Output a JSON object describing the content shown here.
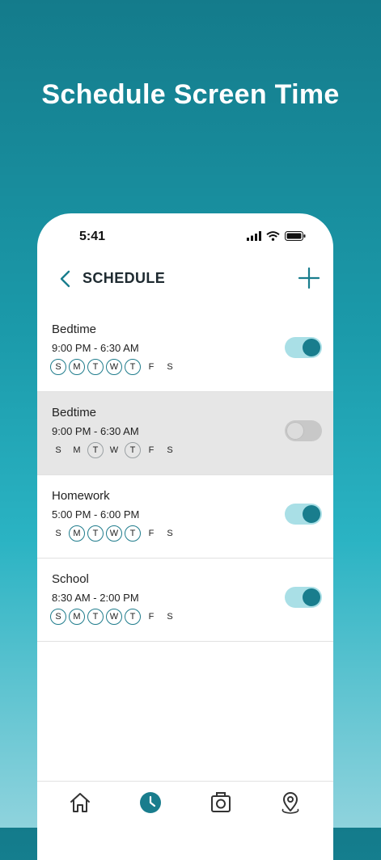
{
  "headline": "Schedule Screen Time",
  "status": {
    "time": "5:41"
  },
  "nav": {
    "title": "SCHEDULE"
  },
  "schedules": [
    {
      "name": "Bedtime",
      "time": "9:00 PM - 6:30 AM",
      "enabled": true,
      "days": [
        {
          "l": "S",
          "on": true
        },
        {
          "l": "M",
          "on": true
        },
        {
          "l": "T",
          "on": true
        },
        {
          "l": "W",
          "on": true
        },
        {
          "l": "T",
          "on": true
        },
        {
          "l": "F",
          "on": false
        },
        {
          "l": "S",
          "on": false
        }
      ]
    },
    {
      "name": "Bedtime",
      "time": "9:00 PM - 6:30 AM",
      "enabled": false,
      "days": [
        {
          "l": "S",
          "on": false
        },
        {
          "l": "M",
          "on": false
        },
        {
          "l": "T",
          "on": true
        },
        {
          "l": "W",
          "on": false
        },
        {
          "l": "T",
          "on": true
        },
        {
          "l": "F",
          "on": false
        },
        {
          "l": "S",
          "on": false
        }
      ]
    },
    {
      "name": "Homework",
      "time": "5:00 PM - 6:00 PM",
      "enabled": true,
      "days": [
        {
          "l": "S",
          "on": false
        },
        {
          "l": "M",
          "on": true
        },
        {
          "l": "T",
          "on": true
        },
        {
          "l": "W",
          "on": true
        },
        {
          "l": "T",
          "on": true
        },
        {
          "l": "F",
          "on": false
        },
        {
          "l": "S",
          "on": false
        }
      ]
    },
    {
      "name": "School",
      "time": "8:30 AM - 2:00 PM",
      "enabled": true,
      "days": [
        {
          "l": "S",
          "on": true
        },
        {
          "l": "M",
          "on": true
        },
        {
          "l": "T",
          "on": true
        },
        {
          "l": "W",
          "on": true
        },
        {
          "l": "T",
          "on": true
        },
        {
          "l": "F",
          "on": false
        },
        {
          "l": "S",
          "on": false
        }
      ]
    }
  ],
  "tabs": [
    {
      "icon": "home-icon",
      "active": false
    },
    {
      "icon": "clock-icon",
      "active": true
    },
    {
      "icon": "camera-icon",
      "active": false
    },
    {
      "icon": "location-pin-icon",
      "active": false
    }
  ],
  "colors": {
    "accent": "#197d8d",
    "toggle_track_on": "#a9dfe6",
    "disabled_row": "#e6e6e6"
  }
}
